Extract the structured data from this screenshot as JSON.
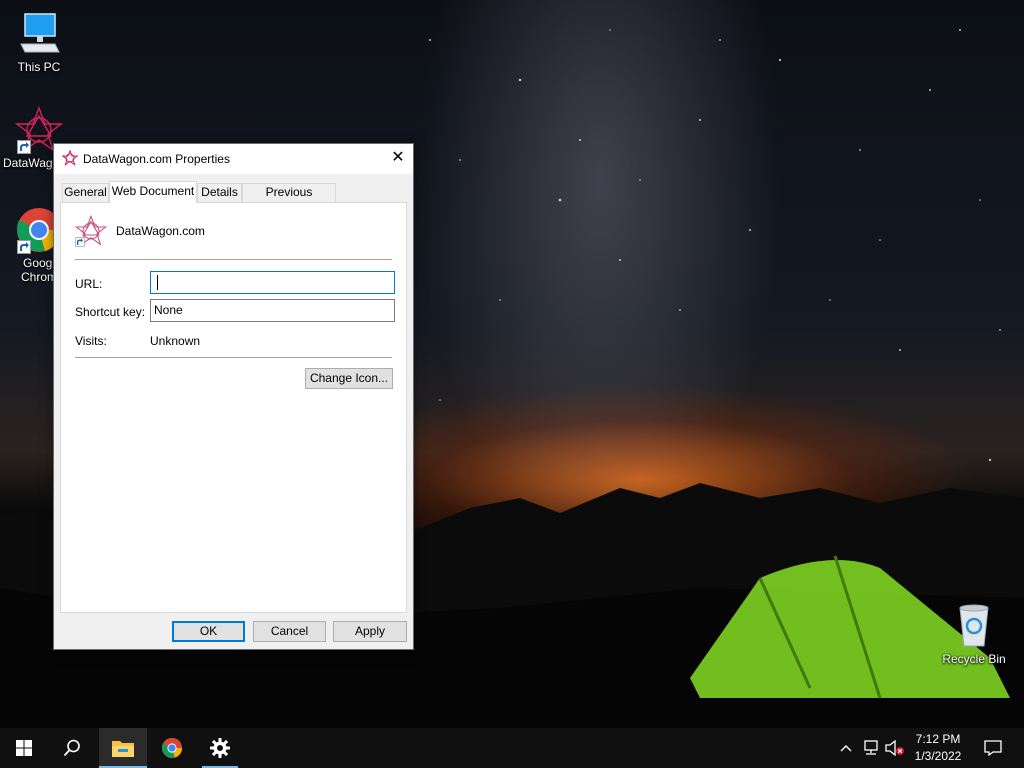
{
  "desktop": {
    "icons": [
      {
        "label": "This PC"
      },
      {
        "label": "DataWag"
      },
      {
        "label_line1": "Googl",
        "label_line2": "Chrom"
      },
      {
        "label": "Recycle Bin"
      }
    ]
  },
  "dialog": {
    "title": "DataWagon.com Properties",
    "close_glyph": "✕",
    "tabs": [
      "General",
      "Web Document",
      "Details",
      "Previous Versions"
    ],
    "active_tab": "Web Document",
    "site_name": "DataWagon.com",
    "url_label": "URL:",
    "url_value": "",
    "shortcut_label": "Shortcut key:",
    "shortcut_value": "None",
    "visits_label": "Visits:",
    "visits_value": "Unknown",
    "change_icon_label": "Change Icon...",
    "ok_label": "OK",
    "cancel_label": "Cancel",
    "apply_label": "Apply"
  },
  "taskbar": {
    "apps": [
      "start-icon",
      "search-icon",
      "file-explorer-icon",
      "chrome-icon",
      "settings-icon"
    ],
    "active_app": "file-explorer-icon",
    "time": "7:12 PM",
    "date": "1/3/2022",
    "tray_icons": [
      "chevron-up-icon",
      "network-icon",
      "volume-muted-icon",
      "notifications-icon"
    ]
  },
  "colors": {
    "accent": "#0078d7",
    "taskbar": "#101010",
    "tent": "#7ed321"
  }
}
